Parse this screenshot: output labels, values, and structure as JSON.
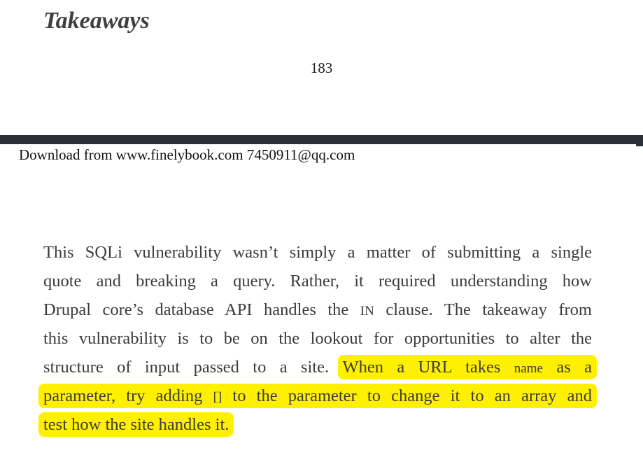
{
  "page": {
    "heading": "Takeaways",
    "page_number": "183",
    "download_note": "Download from www.finelybook.com 7450911@qq.com"
  },
  "paragraph": {
    "line1": "This SQLi vulnerability wasn’t simply a matter of submitting a single",
    "line2": "quote and breaking a query. Rather, it required understanding how",
    "line3_a": "Drupal core’s database API handles the ",
    "line3_code": "IN",
    "line3_b": " clause. The takeaway from",
    "line4": "this vulnerability is to be on the lookout for opportunities to alter the",
    "line5_plain": "structure of input passed to a site. ",
    "line5_hl_a": "When a URL takes ",
    "line5_code": "name",
    "line5_hl_b": " as a",
    "line6_a": "parameter, try adding ",
    "line6_code": "[]",
    "line6_b": " to the parameter to change it to an array and",
    "line7": "test how the site handles it."
  },
  "colors": {
    "highlight": "#fff000",
    "separator": "#2a2f38",
    "body_text": "#3c3c3c"
  }
}
